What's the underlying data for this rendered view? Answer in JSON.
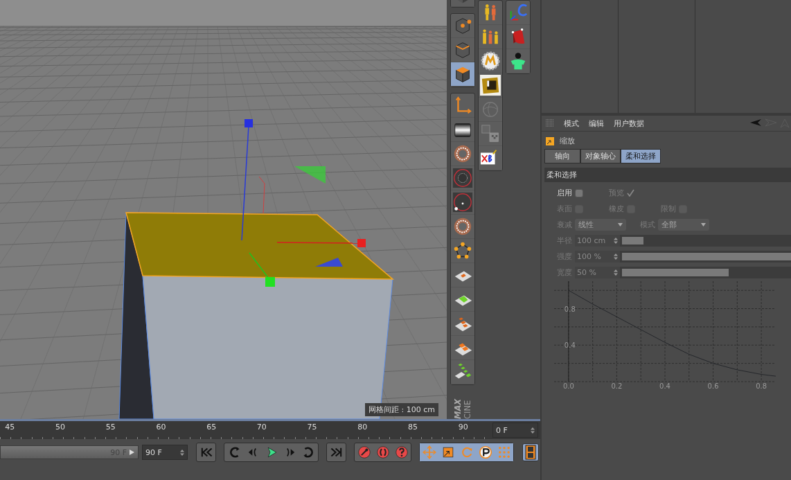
{
  "viewport": {
    "grid_spacing": "网格间距 : 100 cm"
  },
  "tool_columns": [
    {
      "groups": [
        [
          {
            "kind": "cube",
            "selected": false
          }
        ],
        [
          {
            "kind": "points",
            "selected": false
          },
          {
            "kind": "edges",
            "selected": false
          },
          {
            "kind": "polygons",
            "selected": true
          }
        ],
        [
          {
            "kind": "axis",
            "selected": false
          },
          {
            "kind": "gradient",
            "selected": false
          },
          {
            "kind": "burst",
            "selected": false
          },
          {
            "kind": "ring",
            "selected": false
          },
          {
            "kind": "ringdot",
            "selected": false
          },
          {
            "kind": "burst",
            "selected": false
          },
          {
            "kind": "pentagon",
            "selected": false
          },
          {
            "kind": "tileone",
            "selected": false
          },
          {
            "kind": "tilegreen",
            "selected": false
          },
          {
            "kind": "tilesteps",
            "selected": false
          },
          {
            "kind": "tilepair",
            "selected": false
          },
          {
            "kind": "tilestair",
            "selected": false
          }
        ]
      ]
    },
    {
      "groups": [
        [
          {
            "kind": "couple",
            "selected": false
          },
          {
            "kind": "trio",
            "selected": false
          },
          {
            "kind": "badge",
            "selected": false
          },
          {
            "kind": "crate",
            "selected": false
          },
          {
            "kind": "sphere",
            "selected": false
          },
          {
            "kind": "texture",
            "selected": false
          },
          {
            "kind": "letters",
            "selected": false
          }
        ]
      ]
    },
    {
      "groups": [
        [
          {
            "kind": "axisc",
            "selected": false
          },
          {
            "kind": "cloth",
            "selected": false
          },
          {
            "kind": "person",
            "selected": false
          }
        ]
      ]
    }
  ],
  "logo": [
    "MAX",
    "CINE"
  ],
  "timeline": {
    "ruler": [
      "45",
      "50",
      "55",
      "60",
      "65",
      "70",
      "75",
      "80",
      "85",
      "90"
    ],
    "current_frame": "0 F",
    "range": {
      "end": "90 F",
      "level": 1
    },
    "end_frame": "90 F",
    "transport": [
      [
        {
          "kind": "start"
        }
      ],
      [
        {
          "kind": "loopback"
        },
        {
          "kind": "prev"
        },
        {
          "kind": "play"
        },
        {
          "kind": "next"
        },
        {
          "kind": "loopfwd"
        }
      ],
      [
        {
          "kind": "end"
        }
      ]
    ],
    "keys": [
      {
        "kind": "key"
      },
      {
        "kind": "autokey"
      },
      {
        "kind": "help"
      }
    ],
    "modes": [
      {
        "kind": "move",
        "on": true
      },
      {
        "kind": "scale",
        "on": true
      },
      {
        "kind": "rotate",
        "on": true
      },
      {
        "kind": "param",
        "on": true
      },
      {
        "kind": "dots",
        "on": true
      }
    ],
    "film": {
      "on": true
    }
  },
  "attributes": {
    "menu": [
      "模式",
      "编辑",
      "用户数据"
    ],
    "object_name": "缩放",
    "tabs": [
      {
        "label": "轴向",
        "selected": false
      },
      {
        "label": "对象轴心",
        "selected": false
      },
      {
        "label": "柔和选择",
        "selected": true
      }
    ],
    "section": "柔和选择",
    "toggles": [
      [
        {
          "kind": "checkbox",
          "label": "启用",
          "checked": false,
          "disabled": false
        },
        {
          "kind": "tick",
          "label": "预览",
          "checked": true,
          "disabled": true
        }
      ],
      [
        {
          "kind": "checkbox",
          "label": "表面",
          "checked": false,
          "disabled": true
        },
        {
          "kind": "checkbox",
          "label": "橡皮",
          "checked": false,
          "disabled": true
        },
        {
          "kind": "checkbox",
          "label": "限制",
          "checked": false,
          "disabled": true
        }
      ]
    ],
    "dropdowns": [
      {
        "label": "衰减",
        "value": "线性",
        "disabled": true
      },
      {
        "label": "模式",
        "value": "全部",
        "disabled": true
      }
    ],
    "sliders": [
      {
        "label": "半径",
        "value": "100 cm",
        "level": 0.1,
        "disabled": true
      },
      {
        "label": "强度",
        "value": "100 %",
        "level": 1,
        "disabled": true
      },
      {
        "label": "宽度",
        "value": "50 %",
        "level": 0.5,
        "disabled": true
      }
    ],
    "chart_data": {
      "type": "line",
      "x": [
        0,
        0.1,
        0.2,
        0.3,
        0.4,
        0.5,
        0.6,
        0.7,
        0.8,
        0.86
      ],
      "series": [
        {
          "color": "#25272b",
          "values": [
            1,
            0.85,
            0.71,
            0.57,
            0.43,
            0.3,
            0.2,
            0.13,
            0.08,
            0.06
          ]
        }
      ],
      "xlim": [
        -0.06,
        0.86
      ],
      "ylim": [
        0,
        1.1
      ],
      "grid": true,
      "xticks": [
        {
          "value": 0,
          "label": "0.0"
        },
        {
          "value": 0.2,
          "label": "0.2"
        },
        {
          "value": 0.4,
          "label": "0.4"
        },
        {
          "value": 0.6,
          "label": "0.6"
        },
        {
          "value": 0.8,
          "label": "0.8"
        }
      ],
      "yticks": [
        0.8,
        0.4
      ]
    }
  }
}
